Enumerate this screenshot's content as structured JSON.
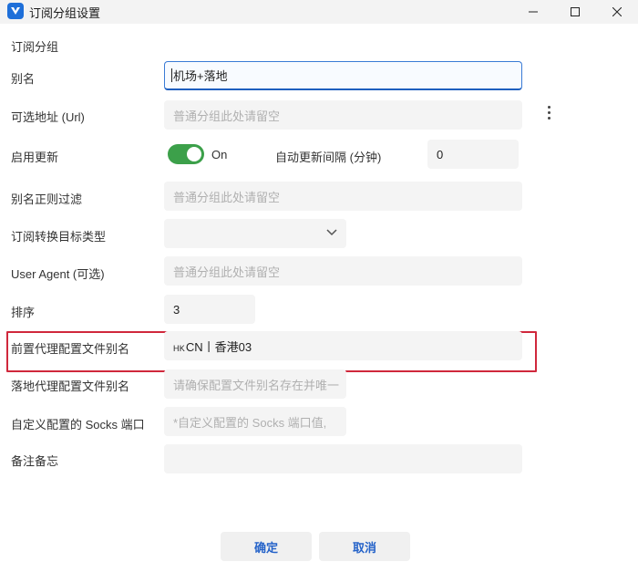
{
  "window": {
    "title": "订阅分组设置"
  },
  "form": {
    "section_title": "订阅分组",
    "alias": {
      "label": "别名",
      "value": "机场+落地"
    },
    "url": {
      "label": "可选地址 (Url)",
      "placeholder": "普通分组此处请留空"
    },
    "auto_update": {
      "label": "启用更新",
      "state_label": "On",
      "enabled": true
    },
    "update_interval": {
      "label": "自动更新间隔 (分钟)",
      "value": "0"
    },
    "alias_regex": {
      "label": "别名正则过滤",
      "placeholder": "普通分组此处请留空"
    },
    "convert_target": {
      "label": "订阅转换目标类型",
      "value": ""
    },
    "user_agent": {
      "label": "User Agent (可选)",
      "placeholder": "普通分组此处请留空"
    },
    "sort": {
      "label": "排序",
      "value": "3"
    },
    "prev_proxy": {
      "label": "前置代理配置文件别名",
      "flag": "HK",
      "value": "CN丨香港03"
    },
    "next_proxy": {
      "label": "落地代理配置文件别名",
      "placeholder": "请确保配置文件别名存在并唯一"
    },
    "socks_port": {
      "label": "自定义配置的 Socks 端口",
      "placeholder": "*自定义配置的 Socks 端口值,"
    },
    "memo": {
      "label": "备注备忘",
      "value": ""
    }
  },
  "actions": {
    "ok_label": "确定",
    "cancel_label": "取消"
  },
  "colors": {
    "accent": "#2563c9",
    "toggle_on": "#3ca04a",
    "highlight": "#d0283c"
  }
}
